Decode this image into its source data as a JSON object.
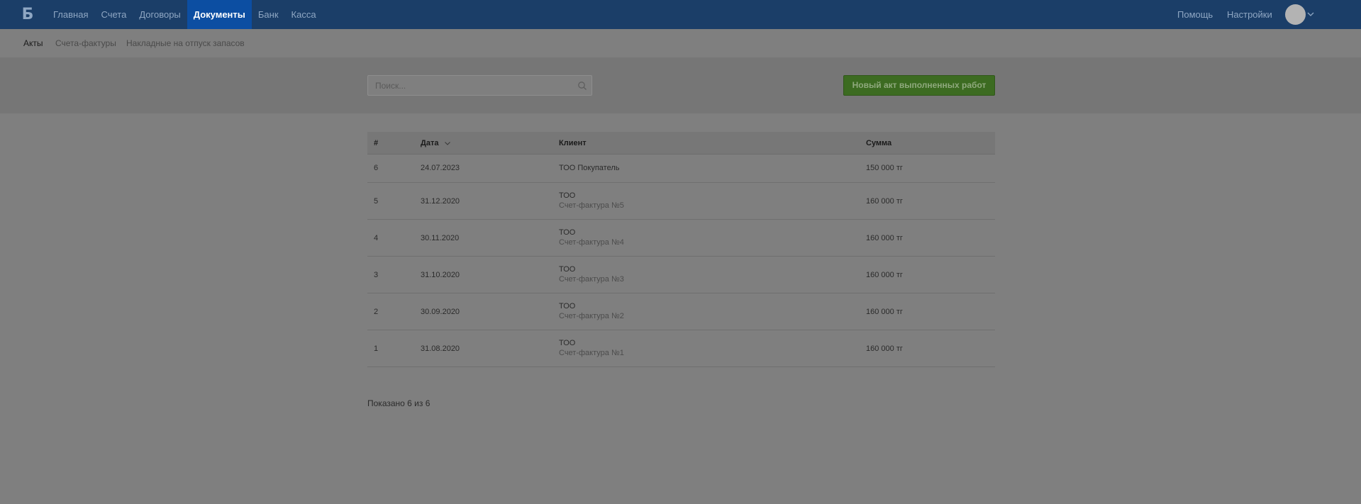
{
  "header": {
    "logo_text": "Б",
    "nav": [
      {
        "label": "Главная"
      },
      {
        "label": "Счета"
      },
      {
        "label": "Договоры"
      },
      {
        "label": "Документы",
        "active": true
      },
      {
        "label": "Банк"
      },
      {
        "label": "Касса"
      }
    ],
    "help_label": "Помощь",
    "settings_label": "Настройки"
  },
  "subnav": {
    "items": [
      {
        "label": "Акты",
        "active": true
      },
      {
        "label": "Счета-фактуры"
      },
      {
        "label": "Накладные на отпуск запасов"
      }
    ]
  },
  "toolbar": {
    "search_placeholder": "Поиск...",
    "search_value": "",
    "new_button_label": "Новый акт выполненных работ"
  },
  "table": {
    "columns": {
      "num": "#",
      "date": "Дата",
      "client": "Клиент",
      "sum": "Сумма"
    },
    "rows": [
      {
        "num": "6",
        "date": "24.07.2023",
        "client": "ТОО Покупатель",
        "client_sub": "",
        "sum": "150 000 тг"
      },
      {
        "num": "5",
        "date": "31.12.2020",
        "client": "ТОО",
        "client_sub": "Счет-фактура №5",
        "sum": "160 000 тг"
      },
      {
        "num": "4",
        "date": "30.11.2020",
        "client": "ТОО",
        "client_sub": "Счет-фактура №4",
        "sum": "160 000 тг"
      },
      {
        "num": "3",
        "date": "31.10.2020",
        "client": "ТОО",
        "client_sub": "Счет-фактура №3",
        "sum": "160 000 тг"
      },
      {
        "num": "2",
        "date": "30.09.2020",
        "client": "ТОО",
        "client_sub": "Счет-фактура №2",
        "sum": "160 000 тг"
      },
      {
        "num": "1",
        "date": "31.08.2020",
        "client": "ТОО",
        "client_sub": "Счет-фактура №1",
        "sum": "160 000 тг"
      }
    ]
  },
  "footer": {
    "shown_text": "Показано 6 из 6"
  },
  "colors": {
    "topbar": "#1b3e68",
    "nav_active": "#0c4ea2",
    "primary_button": "#3c6b21",
    "page_background": "#7f7f7f"
  },
  "icons": {
    "search": "search-icon",
    "sort": "chevron-down-icon",
    "avatar_menu": "chevron-down-icon"
  }
}
